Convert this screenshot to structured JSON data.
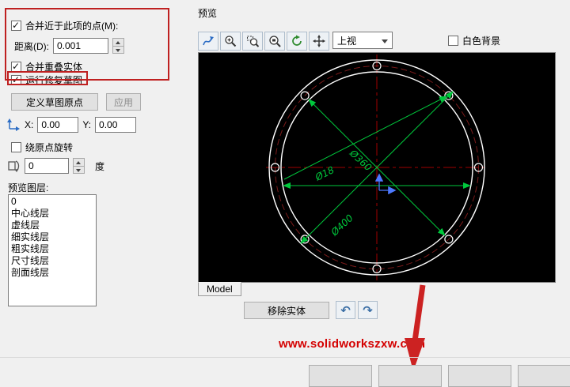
{
  "left_panel": {
    "merge_points": {
      "label": "合并近于此项的点(M):",
      "checked": true
    },
    "distance_label": "距离(D):",
    "distance_value": "0.001",
    "merge_overlap": {
      "label": "合并重叠实体",
      "checked": true
    },
    "repair_sketch": {
      "label": "运行修复草图",
      "checked": true
    },
    "define_origin_button": "定义草图原点",
    "apply_button": "应用",
    "x_label": "X:",
    "x_value": "0.00",
    "y_label": "Y:",
    "y_value": "0.00",
    "rotate_origin": {
      "label": "绕原点旋转",
      "checked": false
    },
    "angle_value": "0",
    "angle_unit": "度",
    "layers_label": "预览图层:",
    "layers": [
      "0",
      "中心线层",
      "虚线层",
      "细实线层",
      "粗实线层",
      "尺寸线层",
      "剖面线层"
    ]
  },
  "preview": {
    "title": "预览",
    "toolbar_icons": [
      "measure-icon",
      "zoom-in-icon",
      "zoom-window-icon",
      "zoom-selection-icon",
      "refresh-icon",
      "pan-icon"
    ],
    "view_selected": "上视",
    "white_background_label": "白色背景",
    "model_tab": "Model",
    "remove_entities_button": "移除实体",
    "dim_labels": {
      "d360": "Ø360",
      "d18": "Ø18",
      "d400": "Ø400"
    }
  },
  "watermark": "www.solidworkszxw.com",
  "colors": {
    "annotation_red": "#bf2020",
    "dimension_green": "#00c83c",
    "centerline_red": "#a00000",
    "watermark_red": "#d40000",
    "preview_background": "#000000"
  }
}
